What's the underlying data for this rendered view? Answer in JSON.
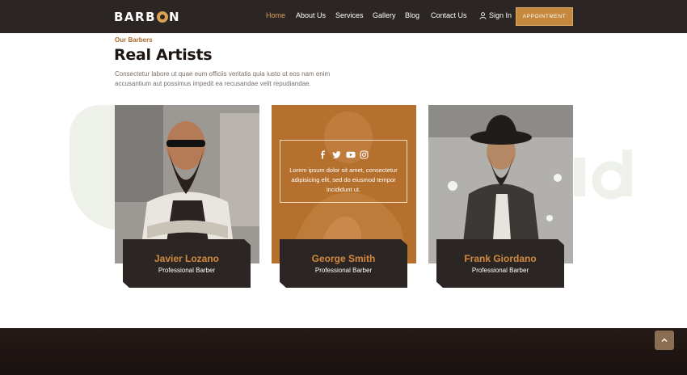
{
  "brand": {
    "logo_left": "BARB",
    "logo_right": "N"
  },
  "nav": {
    "items": [
      {
        "label": "Home",
        "active": true
      },
      {
        "label": "About Us"
      },
      {
        "label": "Services"
      },
      {
        "label": "Gallery"
      },
      {
        "label": "Blog"
      },
      {
        "label": "Contact Us"
      }
    ],
    "signin": "Sign In",
    "appointment": "APPOINTMENT"
  },
  "section": {
    "eyebrow": "Our Barbers",
    "title": "Real Artists",
    "description": "Consectetur labore ut quae eum officiis veritatis quia iusto ut eos nam enim accusantium aut possimus impedit ea recusandae velit repudiandae."
  },
  "team": [
    {
      "name": "Javier Lozano",
      "role": "Professional Barber"
    },
    {
      "name": "George Smith",
      "role": "Professional Barber",
      "overlay": "Lorem ipsum dolor sit amet, consectetur adipisicing elit, sed do eiusmod tempor incididunt ut."
    },
    {
      "name": "Frank Giordano",
      "role": "Professional Barber"
    }
  ],
  "icons": {
    "social": [
      "facebook-icon",
      "twitter-icon",
      "youtube-icon",
      "instagram-icon"
    ],
    "back_to_top": "chevron-up-icon"
  },
  "colors": {
    "accent": "#c4883f",
    "dark": "#2b2523",
    "name": "#d38a3e"
  }
}
